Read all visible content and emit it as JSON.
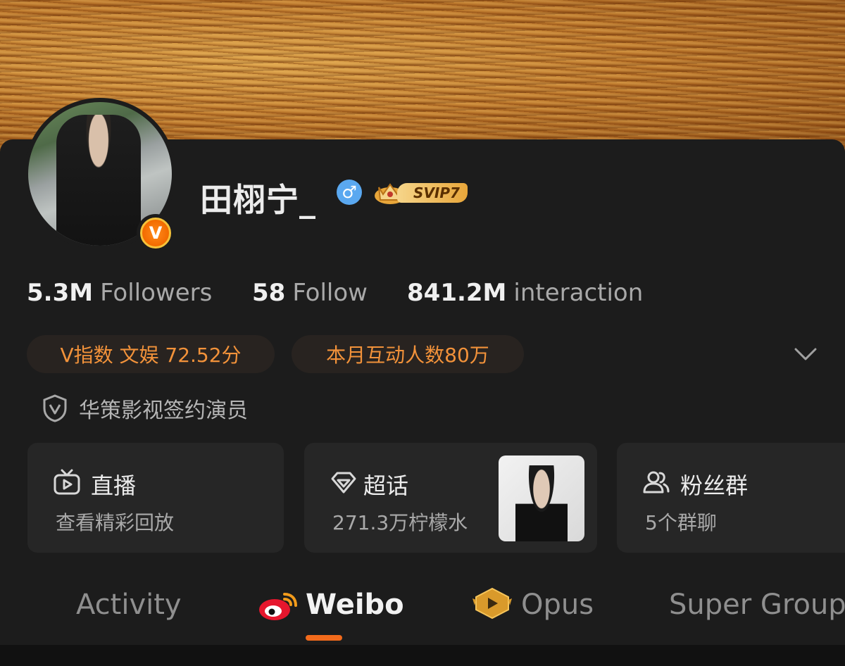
{
  "profile": {
    "name": "田栩宁_",
    "gender_symbol": "♂",
    "vip_label": "SVIP7",
    "verified_badge": "V",
    "verification_text": "华策影视签约演员"
  },
  "stats": [
    {
      "num": "5.3M",
      "label": "Followers"
    },
    {
      "num": "58",
      "label": "Follow"
    },
    {
      "num": "841.2M",
      "label": "interaction"
    }
  ],
  "pills": {
    "v_index": "V指数 文娱 72.52分",
    "monthly": "本月互动人数80万"
  },
  "tiles": {
    "live": {
      "title": "直播",
      "sub": "查看精彩回放"
    },
    "super_topic": {
      "title": "超话",
      "sub": "271.3万柠檬水"
    },
    "fan_group": {
      "title": "粉丝群",
      "sub": "5个群聊"
    }
  },
  "tabs": {
    "activity": "Activity",
    "weibo": "Weibo",
    "opus": "Opus",
    "super_group": "Super Group"
  },
  "colors": {
    "accent": "#f26a1b",
    "pill_text": "#f2923a",
    "card_bg": "#1c1c1c",
    "tile_bg": "#262626"
  }
}
